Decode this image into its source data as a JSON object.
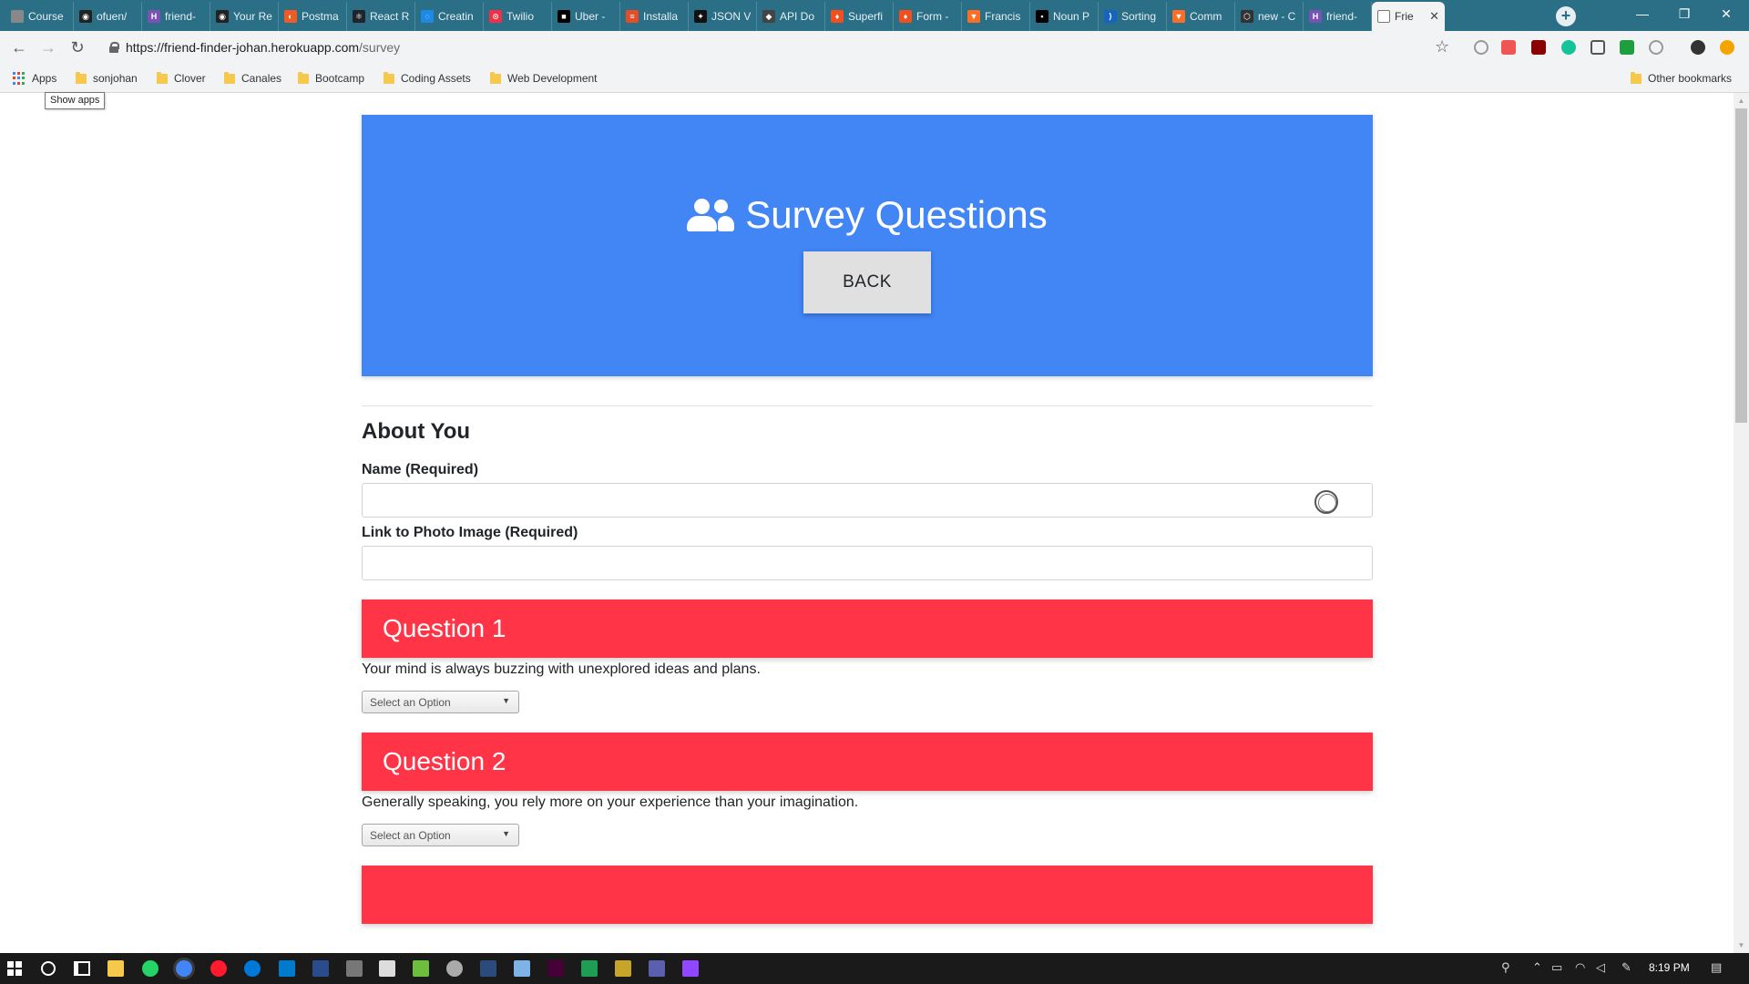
{
  "browser": {
    "tabs": [
      {
        "title": "Course",
        "color": "#888888",
        "glyph": ""
      },
      {
        "title": "ofuen/",
        "color": "#222222",
        "glyph": "◉"
      },
      {
        "title": "friend-",
        "color": "#7952b3",
        "glyph": "H"
      },
      {
        "title": "Your Re",
        "color": "#222222",
        "glyph": "◉"
      },
      {
        "title": "Postma",
        "color": "#ef5b25",
        "glyph": "◐"
      },
      {
        "title": "React R",
        "color": "#20232a",
        "glyph": "⚛"
      },
      {
        "title": "Creatin",
        "color": "#1e88e5",
        "glyph": "◌"
      },
      {
        "title": "Twilio",
        "color": "#f22f46",
        "glyph": "⊙"
      },
      {
        "title": "Uber -",
        "color": "#000000",
        "glyph": "■"
      },
      {
        "title": "Installa",
        "color": "#e44d26",
        "glyph": "≡"
      },
      {
        "title": "JSON V",
        "color": "#111111",
        "glyph": "✦"
      },
      {
        "title": "API Do",
        "color": "#444444",
        "glyph": "◆"
      },
      {
        "title": "Superfi",
        "color": "#f24e1e",
        "glyph": "♦"
      },
      {
        "title": "Form -",
        "color": "#f24e1e",
        "glyph": "♦"
      },
      {
        "title": "Francis",
        "color": "#fc6d26",
        "glyph": "▼"
      },
      {
        "title": "Noun P",
        "color": "#000000",
        "glyph": "▪"
      },
      {
        "title": "Sorting",
        "color": "#1565c0",
        "glyph": "⟩"
      },
      {
        "title": "Comm",
        "color": "#fc6d26",
        "glyph": "▼"
      },
      {
        "title": "new - C",
        "color": "#333333",
        "glyph": "⬡"
      },
      {
        "title": "friend-",
        "color": "#7952b3",
        "glyph": "H"
      }
    ],
    "active_tab": {
      "title": "Frie",
      "close": "✕"
    },
    "new_tab": "+",
    "window_controls": {
      "minimize": "—",
      "restore": "❐",
      "close": "✕"
    },
    "nav": {
      "back": "←",
      "forward": "→",
      "reload": "↻"
    },
    "url_host": "https://friend-finder-johan.herokuapp.com",
    "url_path": "/survey",
    "bookmark_star": "☆",
    "bookmarks": {
      "apps": "Apps",
      "items": [
        "sonjohan",
        "Clover",
        "Canales",
        "Bootcamp",
        "Coding Assets",
        "Web Development"
      ],
      "other": "Other bookmarks"
    },
    "tooltip": "Show apps"
  },
  "page": {
    "title": "Survey Questions",
    "back_button": "BACK",
    "about_heading": "About You",
    "name_label": "Name (Required)",
    "photo_label": "Link to Photo Image (Required)",
    "questions": [
      {
        "header": "Question 1",
        "text": "Your mind is always buzzing with unexplored ideas and plans.",
        "select": "Select an Option"
      },
      {
        "header": "Question 2",
        "text": "Generally speaking, you rely more on your experience than your imagination.",
        "select": "Select an Option"
      }
    ],
    "colors": {
      "primary": "#4285f4",
      "question": "#ff3547",
      "button": "#e0e0e0"
    }
  },
  "taskbar": {
    "time": "8:19 PM",
    "apps": [
      "file-explorer",
      "whatsapp",
      "chrome",
      "opera",
      "edge",
      "vscode",
      "powershell",
      "unknown",
      "mail",
      "app",
      "app",
      "app",
      "app",
      "adobe-xd",
      "app",
      "app",
      "app",
      "twitch"
    ]
  }
}
